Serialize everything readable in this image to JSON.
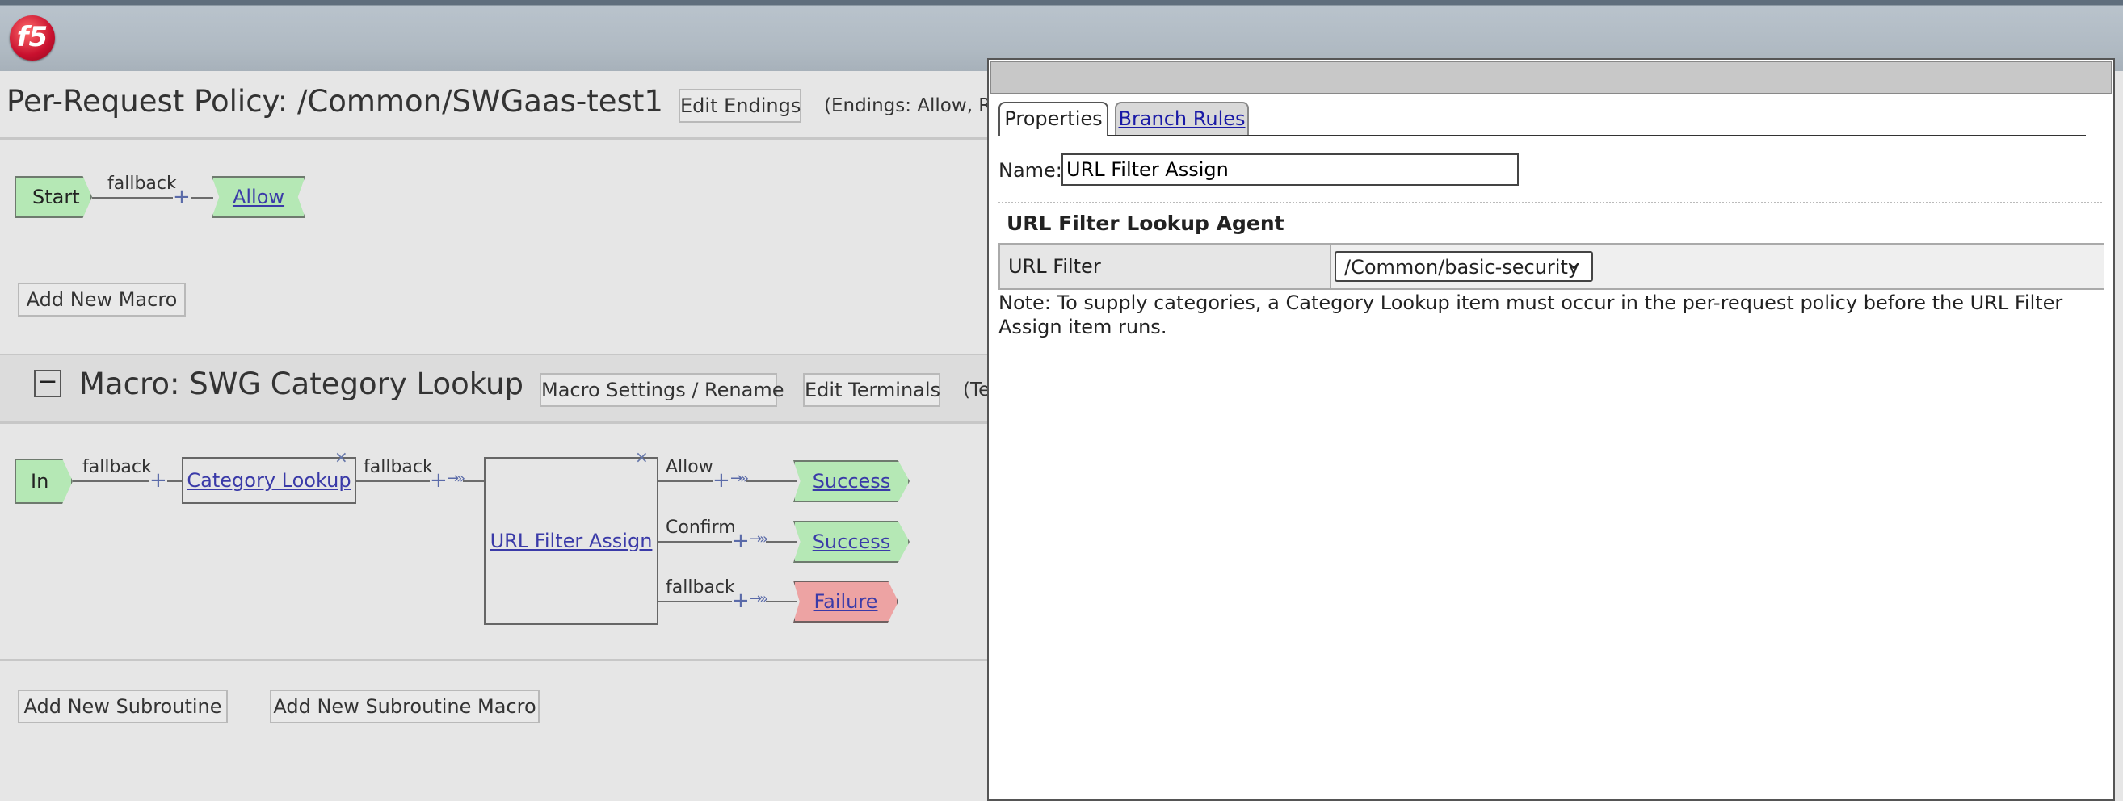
{
  "logo_text": "f5",
  "policy": {
    "title": "Per-Request Policy: /Common/SWGaas-test1",
    "edit_endings": "Edit Endings",
    "endings_text": "(Endings: Allow, Rej",
    "start": "Start",
    "fallback": "fallback",
    "allow": "Allow",
    "add_macro": "Add New Macro"
  },
  "macro": {
    "collapse_symbol": "−",
    "title": "Macro: SWG Category Lookup",
    "settings": "Macro Settings / Rename",
    "edit_terminals": "Edit Terminals",
    "terminals_text": "(Te",
    "in": "In",
    "fallback1": "fallback",
    "category_lookup": "Category Lookup",
    "fallback2": "fallback",
    "url_filter_assign": "URL Filter Assign",
    "branches": [
      {
        "label": "Allow",
        "ending": "Success"
      },
      {
        "label": "Confirm",
        "ending": "Success"
      },
      {
        "label": "fallback",
        "ending": "Failure"
      }
    ]
  },
  "bottom": {
    "add_subroutine": "Add New Subroutine",
    "add_subroutine_macro": "Add New Subroutine Macro"
  },
  "dialog": {
    "tabs": [
      "Properties",
      "Branch Rules"
    ],
    "name_label": "Name:",
    "name_value": "URL Filter Assign",
    "section": "URL Filter Lookup Agent",
    "field_label": "URL Filter",
    "field_value": "/Common/basic-security",
    "note": "Note: To supply categories, a Category Lookup item must occur in the per-request policy before the URL Filter Assign item runs."
  },
  "icons": {
    "plus": "+",
    "arrow": "→»",
    "close": "×",
    "chevron": "⌄"
  }
}
